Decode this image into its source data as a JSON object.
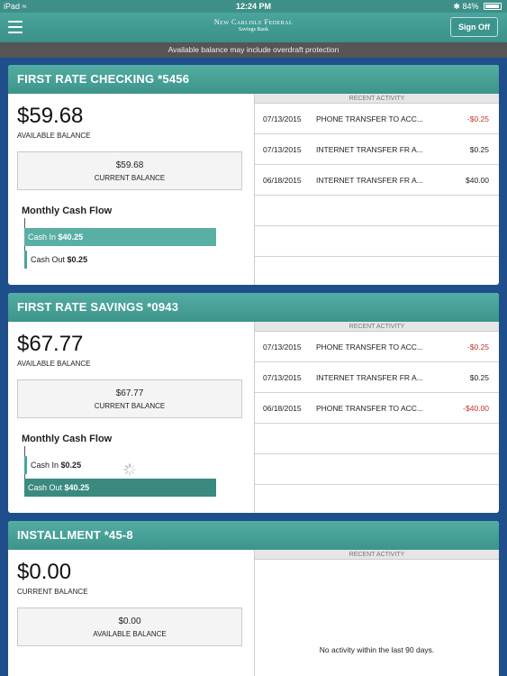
{
  "status_bar": {
    "device": "iPad",
    "time": "12:24 PM",
    "battery": "84%"
  },
  "nav": {
    "brand_name": "New Carlisle Federal",
    "brand_sub": "Savings Bank",
    "sign_off_label": "Sign Off"
  },
  "notice": "Available balance may include overdraft protection",
  "accounts": [
    {
      "title": "FIRST RATE CHECKING *5456",
      "primary_amount": "$59.68",
      "primary_label": "AVAILABLE BALANCE",
      "secondary_amount": "$59.68",
      "secondary_label": "CURRENT BALANCE",
      "cash_flow_title": "Monthly Cash Flow",
      "cash_in_label": "Cash In",
      "cash_in_value": "$40.25",
      "cash_out_label": "Cash Out",
      "cash_out_value": "$0.25",
      "recent_header": "RECENT ACTIVITY",
      "activity": [
        {
          "date": "07/13/2015",
          "desc": "PHONE TRANSFER TO ACC...",
          "amount": "-$0.25"
        },
        {
          "date": "07/13/2015",
          "desc": "INTERNET TRANSFER FR A...",
          "amount": "$0.25"
        },
        {
          "date": "06/18/2015",
          "desc": "INTERNET TRANSFER FR A...",
          "amount": "$40.00"
        }
      ]
    },
    {
      "title": "FIRST RATE SAVINGS *0943",
      "primary_amount": "$67.77",
      "primary_label": "AVAILABLE BALANCE",
      "secondary_amount": "$67.77",
      "secondary_label": "CURRENT BALANCE",
      "cash_flow_title": "Monthly Cash Flow",
      "cash_in_label": "Cash In",
      "cash_in_value": "$0.25",
      "cash_out_label": "Cash Out",
      "cash_out_value": "$40.25",
      "recent_header": "RECENT ACTIVITY",
      "activity": [
        {
          "date": "07/13/2015",
          "desc": "PHONE TRANSFER TO ACC...",
          "amount": "-$0.25"
        },
        {
          "date": "07/13/2015",
          "desc": "INTERNET TRANSFER FR A...",
          "amount": "$0.25"
        },
        {
          "date": "06/18/2015",
          "desc": "PHONE TRANSFER TO ACC...",
          "amount": "-$40.00"
        }
      ]
    },
    {
      "title": "INSTALLMENT *45-8",
      "primary_amount": "$0.00",
      "primary_label": "CURRENT BALANCE",
      "secondary_amount": "$0.00",
      "secondary_label": "AVAILABLE BALANCE",
      "recent_header": "RECENT ACTIVITY",
      "no_activity": "No activity within the last 90 days."
    }
  ],
  "colors": {
    "brand_teal": "#4aa59c",
    "background_blue": "#1f4f8a",
    "negative_red": "#c0322b"
  }
}
